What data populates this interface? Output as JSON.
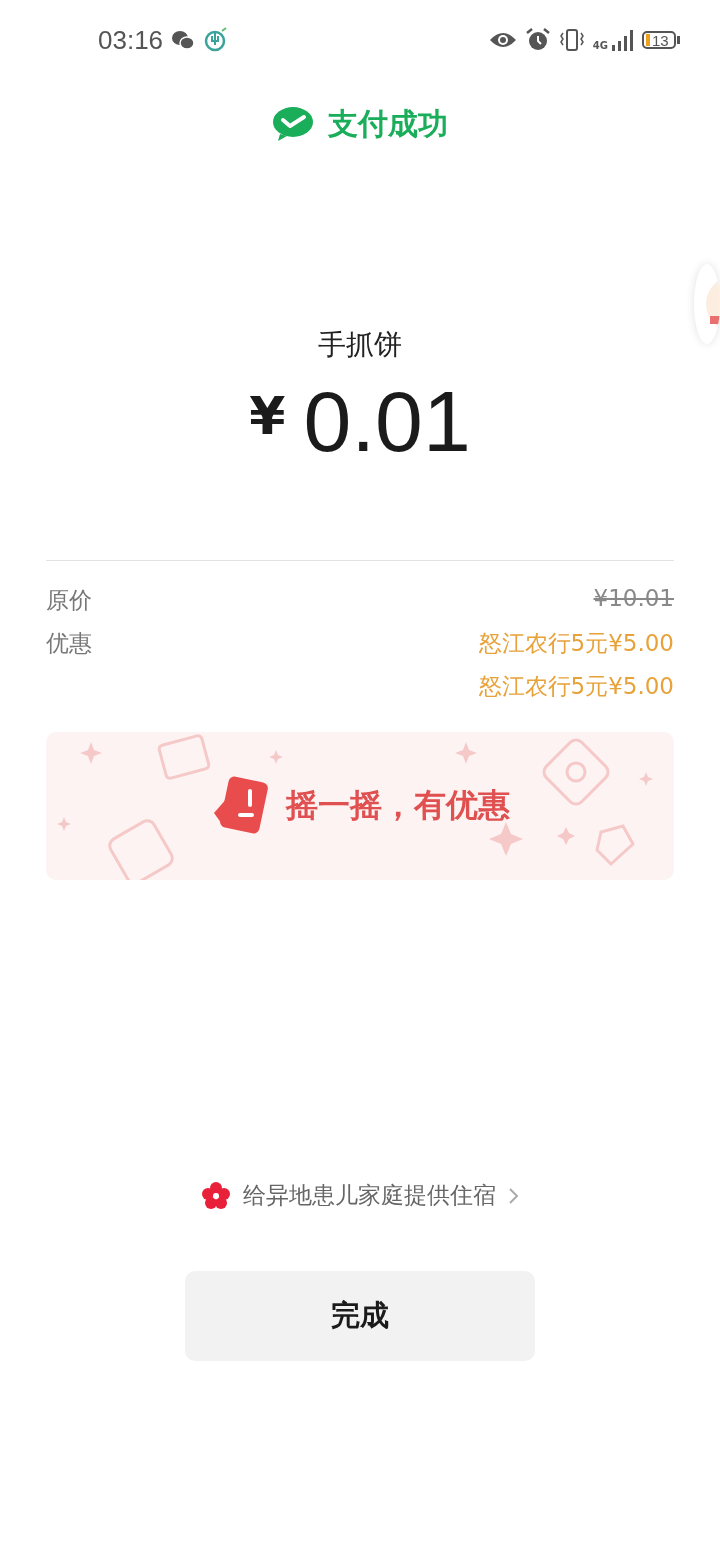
{
  "status_bar": {
    "time": "03:16",
    "network": "4G",
    "battery": "13"
  },
  "header": {
    "title": "支付成功"
  },
  "merchant": "手抓饼",
  "amount": {
    "currency": "¥",
    "value": "0.01"
  },
  "details": [
    {
      "label": "原价",
      "values": [
        {
          "text": "¥10.01",
          "kind": "strike"
        }
      ]
    },
    {
      "label": "优惠",
      "values": [
        {
          "text": "怒江农行5元¥5.00",
          "kind": "discount"
        },
        {
          "text": "怒江农行5元¥5.00",
          "kind": "discount"
        }
      ]
    }
  ],
  "promo_banner": {
    "text": "摇一摇，有优惠"
  },
  "charity_link": {
    "text": "给异地患儿家庭提供住宿"
  },
  "done_button": {
    "label": "完成"
  }
}
